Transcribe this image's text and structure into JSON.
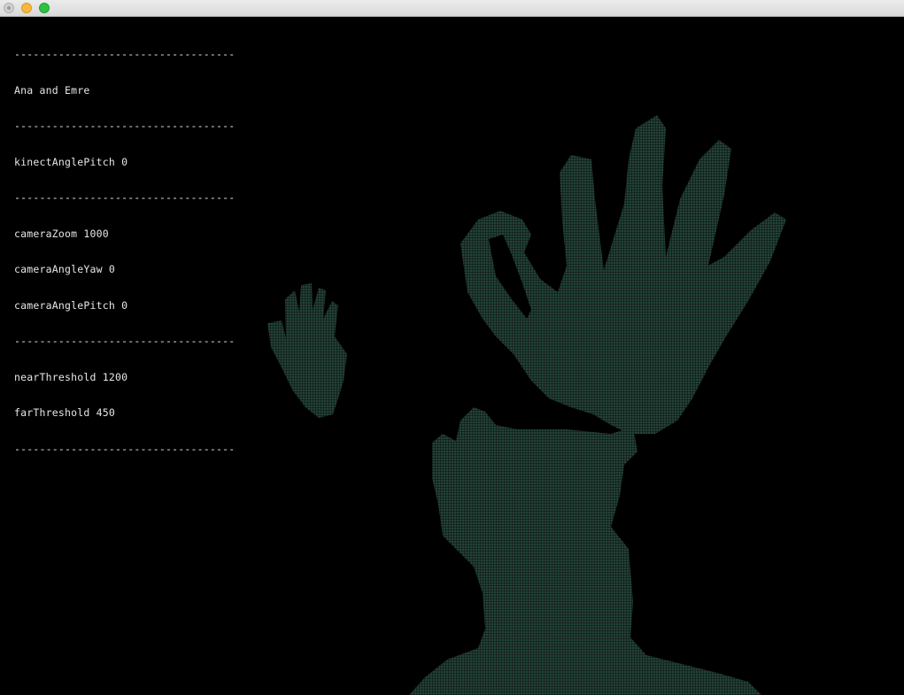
{
  "window": {
    "buttons": [
      "close",
      "minimize",
      "maximize"
    ]
  },
  "overlay": {
    "divider": "-----------------------------------",
    "title": "Ana and Emre",
    "kinect_angle_pitch": "kinectAnglePitch 0",
    "camera_zoom": "cameraZoom 1000",
    "camera_angle_yaw": "cameraAngleYaw 0",
    "camera_angle_pitch": "cameraAnglePitch 0",
    "near_threshold": "nearThreshold 1200",
    "far_threshold": "farThreshold 450"
  },
  "colors": {
    "background": "#000000",
    "point_cloud": "#1f3b33",
    "text": "#e6e6e6"
  }
}
